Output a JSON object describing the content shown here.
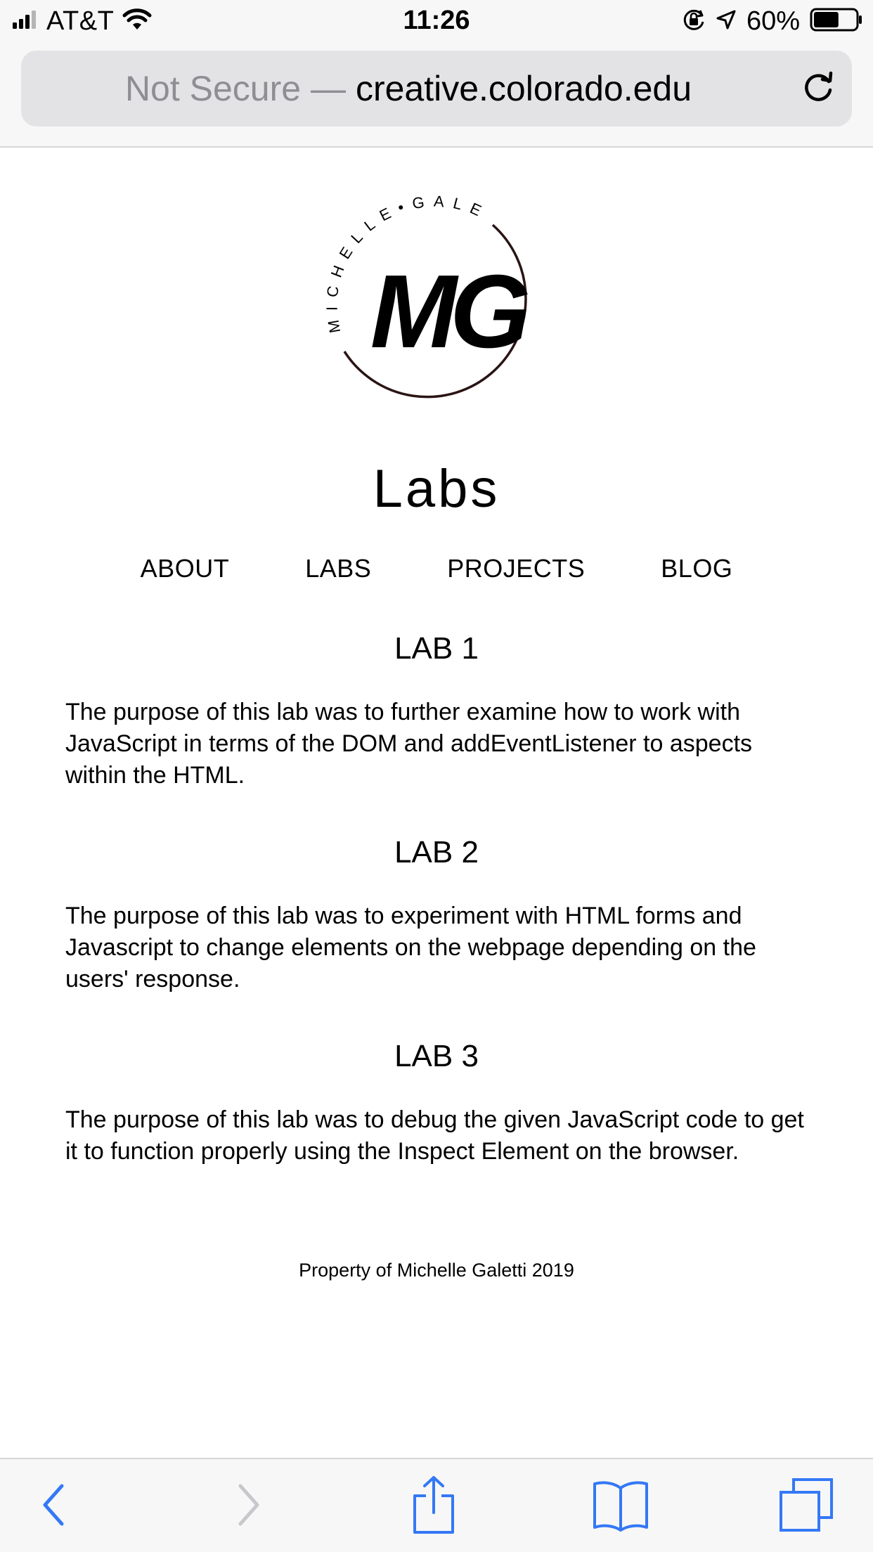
{
  "status_bar": {
    "carrier": "AT&T",
    "time": "11:26",
    "battery_percent": "60%",
    "battery_level": 0.6,
    "icons": [
      "signal-bars-icon",
      "wifi-icon",
      "orientation-lock-icon",
      "location-arrow-icon",
      "battery-icon"
    ]
  },
  "browser": {
    "url_security": "Not Secure —",
    "url_domain": "creative.colorado.edu"
  },
  "logo": {
    "monogram": "MG",
    "ring_text": "MICHELLE•GALETTI"
  },
  "page": {
    "title": "Labs",
    "nav": [
      "ABOUT",
      "LABS",
      "PROJECTS",
      "BLOG"
    ],
    "labs": [
      {
        "heading": "LAB 1",
        "text": "The purpose of this lab was to further examine how to work with JavaScript in terms of the DOM and addEventListener to aspects within the HTML."
      },
      {
        "heading": "LAB 2",
        "text": "The purpose of this lab was to experiment with HTML forms and Javascript to change elements on the webpage depending on the users' response."
      },
      {
        "heading": "LAB 3",
        "text": "The purpose of this lab was to debug the given JavaScript code to get it to function properly using the Inspect Element on the browser."
      }
    ],
    "footer": "Property of Michelle Galetti 2019"
  },
  "toolbar": {
    "icons": [
      "back-icon",
      "forward-icon",
      "share-icon",
      "bookmarks-icon",
      "tabs-icon"
    ],
    "accent_color": "#3478f6",
    "disabled_color": "#c7c7cc"
  }
}
